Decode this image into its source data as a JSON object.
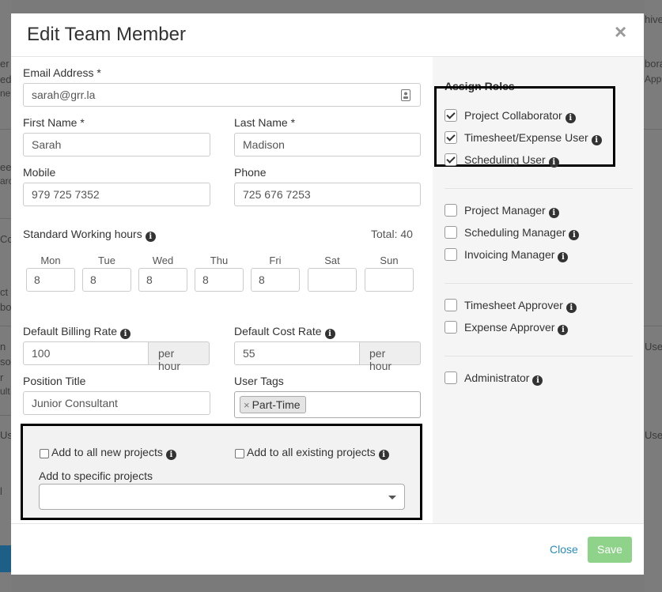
{
  "background": {
    "fragments": [
      "hive",
      "er",
      "ed",
      "ne",
      "ee",
      "arc",
      "Co",
      "ct",
      "bo",
      "n",
      "so",
      "r",
      "ult",
      "Us",
      "l",
      "bora",
      "Appr",
      "Use",
      "Use"
    ]
  },
  "modal": {
    "title": "Edit Team Member",
    "close_icon": "×"
  },
  "form": {
    "email": {
      "label": "Email Address",
      "required": "*",
      "value": "sarah@grr.la"
    },
    "first_name": {
      "label": "First Name",
      "required": "*",
      "value": "Sarah"
    },
    "last_name": {
      "label": "Last Name",
      "required": "*",
      "value": "Madison"
    },
    "mobile": {
      "label": "Mobile",
      "value": "979 725 7352"
    },
    "phone": {
      "label": "Phone",
      "value": "725 676 7253"
    },
    "working_hours": {
      "label": "Standard Working hours",
      "total": "Total: 40",
      "days": [
        {
          "name": "Mon",
          "value": "8"
        },
        {
          "name": "Tue",
          "value": "8"
        },
        {
          "name": "Wed",
          "value": "8"
        },
        {
          "name": "Thu",
          "value": "8"
        },
        {
          "name": "Fri",
          "value": "8"
        },
        {
          "name": "Sat",
          "value": ""
        },
        {
          "name": "Sun",
          "value": ""
        }
      ]
    },
    "billing_rate": {
      "label": "Default Billing Rate",
      "value": "100",
      "unit": "per hour"
    },
    "cost_rate": {
      "label": "Default Cost Rate",
      "value": "55",
      "unit": "per hour"
    },
    "position_title": {
      "label": "Position Title",
      "value": "Junior Consultant"
    },
    "user_tags": {
      "label": "User Tags",
      "tags": [
        "Part-Time"
      ],
      "remove": "×"
    },
    "projects": {
      "all_new": "Add to all new projects",
      "all_existing": "Add to all existing projects",
      "specific_label": "Add to specific projects",
      "specific_value": ""
    }
  },
  "roles": {
    "title": "Assign Roles",
    "items": [
      {
        "label": "Project Collaborator",
        "checked": true
      },
      {
        "label": "Timesheet/Expense User",
        "checked": true
      },
      {
        "label": "Scheduling User",
        "checked": true
      },
      {
        "label": "Project Manager",
        "checked": false
      },
      {
        "label": "Scheduling Manager",
        "checked": false
      },
      {
        "label": "Invoicing Manager",
        "checked": false
      },
      {
        "label": "Timesheet Approver",
        "checked": false
      },
      {
        "label": "Expense Approver",
        "checked": false
      },
      {
        "label": "Administrator",
        "checked": false
      }
    ]
  },
  "footer": {
    "close_label": "Close",
    "save_label": "Save"
  },
  "icons": {
    "info": "i",
    "contact_card": "contact-card-icon"
  },
  "colors": {
    "link": "#2a8bbd",
    "save_button": "#8fd38b",
    "highlight_border": "#000000"
  }
}
